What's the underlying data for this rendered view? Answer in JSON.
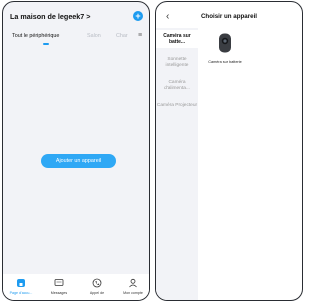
{
  "home": {
    "title": "La maison de legeek7 >",
    "tabs": [
      "Tout le périphérique",
      "Salon",
      "Char"
    ],
    "add_button": "Ajouter un appareil",
    "tabbar": [
      "Page d'accu...",
      "Messages",
      "Appel de",
      "Mon compte"
    ]
  },
  "chooser": {
    "title": "Choisir un appareil",
    "categories": [
      "Caméra sur batte...",
      "Sonnette intelligente",
      "Caméra d'alimenta...",
      "Caméra Projecteur"
    ],
    "product_label": "Caméra sur batterie"
  },
  "colors": {
    "accent": "#1d9bf0"
  },
  "icons": [
    "plus-circle-icon",
    "menu-icon",
    "home-icon",
    "message-icon",
    "phone-icon",
    "user-icon",
    "back-arrow-icon",
    "battery-camera-icon"
  ]
}
